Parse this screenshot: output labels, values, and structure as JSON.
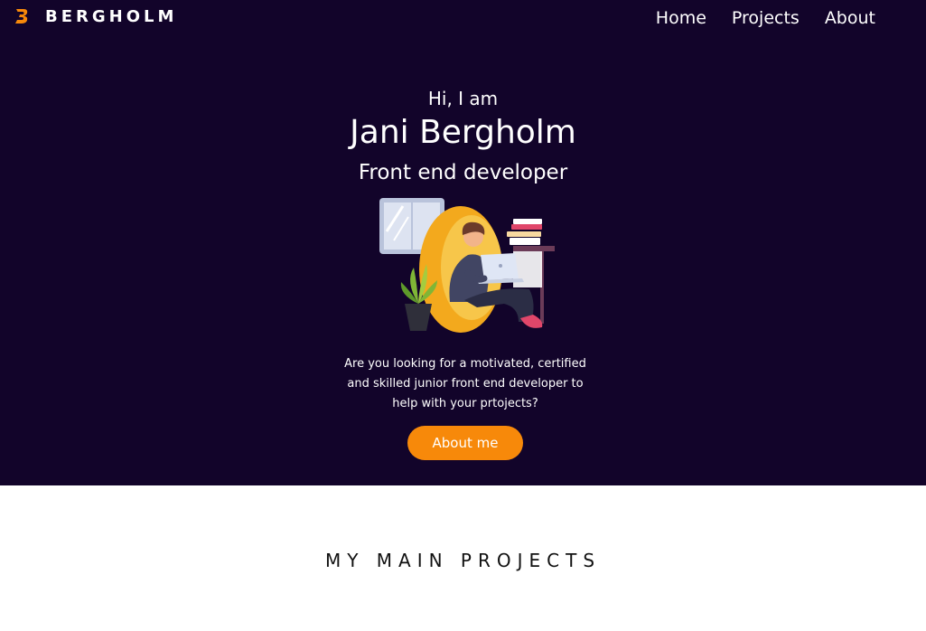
{
  "brand": {
    "name": "BERGHOLM",
    "logo_icon": "b-logo-icon"
  },
  "nav": {
    "items": [
      "Home",
      "Projects",
      "About"
    ]
  },
  "hero": {
    "greeting": "Hi, I am",
    "name": "Jani Bergholm",
    "role": "Front end developer",
    "intro": "Are you looking for a motivated, certified and skilled junior front end developer to help with your prtojects?",
    "cta_label": "About me",
    "illustration_icon": "developer-with-laptop-illustration"
  },
  "projects": {
    "title": "MY MAIN PROJECTS"
  },
  "colors": {
    "hero_bg": "#12042a",
    "accent": "#f7890a",
    "text_light": "#ffffff",
    "page_bg": "#ffffff"
  }
}
